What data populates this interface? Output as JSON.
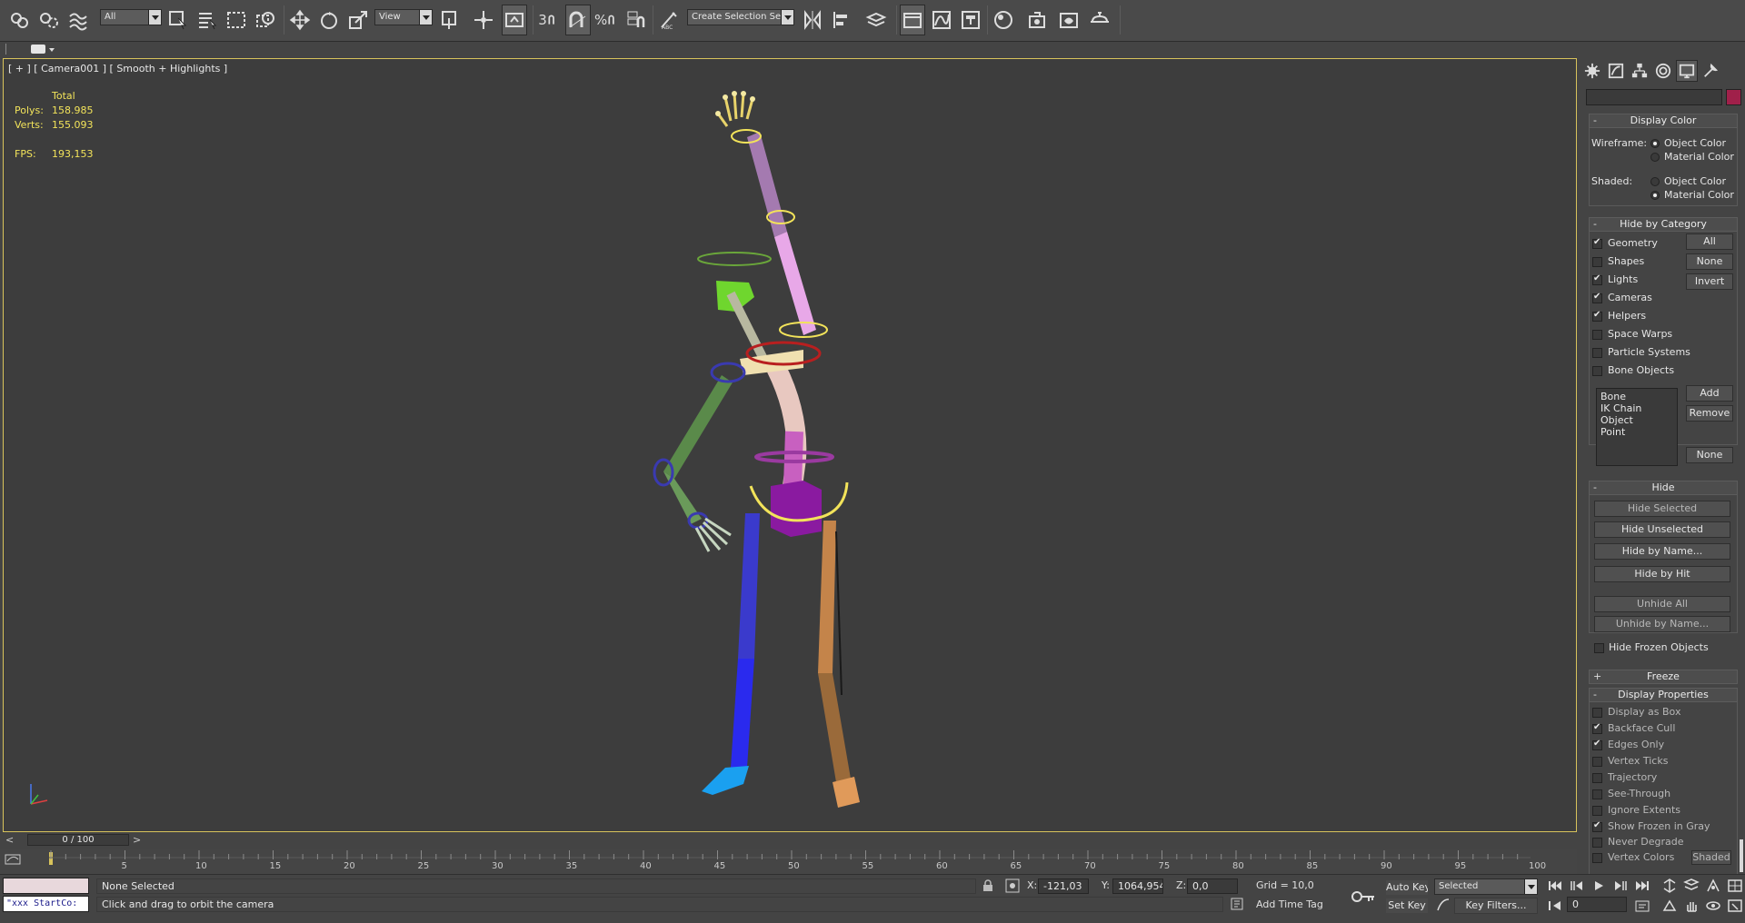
{
  "toolbar": {
    "selection_filter": "All",
    "reference_coord": "View",
    "named_selection": "Create Selection Se",
    "snap_label": "3",
    "percent_label": "%"
  },
  "viewport": {
    "label": "[ + ] [ Camera001 ] [ Smooth + Highlights ]",
    "stats": {
      "total_label": "Total",
      "polys_label": "Polys:",
      "polys_value": "158.985",
      "verts_label": "Verts:",
      "verts_value": "155.093",
      "fps_label": "FPS:",
      "fps_value": "193,153"
    }
  },
  "timeline": {
    "frame_display": "0 / 100",
    "prev": "<",
    "next": ">",
    "ticks": [
      "5",
      "10",
      "15",
      "20",
      "25",
      "30",
      "35",
      "40",
      "45",
      "50",
      "55",
      "60",
      "65",
      "70",
      "75",
      "80",
      "85",
      "90",
      "95",
      "100"
    ]
  },
  "status": {
    "maxscript_text": "\"xxx StartCo:",
    "selection_status": "None Selected",
    "prompt": "Click and drag to orbit the camera",
    "x_label": "X:",
    "x_value": "-121,03",
    "y_label": "Y:",
    "y_value": "1064,954",
    "z_label": "Z:",
    "z_value": "0,0",
    "grid": "Grid = 10,0",
    "add_time_tag": "Add Time Tag",
    "auto_key": "Auto Key",
    "set_key": "Set Key",
    "key_mode": "Selected",
    "key_filters": "Key Filters...",
    "current_frame": "0"
  },
  "command_panel": {
    "display_color": {
      "title": "Display Color",
      "wireframe_label": "Wireframe:",
      "shaded_label": "Shaded:",
      "object_color": "Object Color",
      "material_color": "Material Color"
    },
    "hide_by_category": {
      "title": "Hide by Category",
      "items": [
        {
          "label": "Geometry",
          "checked": true
        },
        {
          "label": "Shapes",
          "checked": false
        },
        {
          "label": "Lights",
          "checked": true
        },
        {
          "label": "Cameras",
          "checked": true
        },
        {
          "label": "Helpers",
          "checked": true
        },
        {
          "label": "Space Warps",
          "checked": false
        },
        {
          "label": "Particle Systems",
          "checked": false
        },
        {
          "label": "Bone Objects",
          "checked": false
        }
      ],
      "all_btn": "All",
      "none_btn": "None",
      "invert_btn": "Invert",
      "list_items": [
        "Bone",
        "IK Chain Object",
        "Point"
      ],
      "add_btn": "Add",
      "remove_btn": "Remove",
      "none_btn2": "None"
    },
    "hide": {
      "title": "Hide",
      "hide_selected": "Hide Selected",
      "hide_unselected": "Hide Unselected",
      "hide_by_name": "Hide by Name...",
      "hide_by_hit": "Hide by Hit",
      "unhide_all": "Unhide All",
      "unhide_by_name": "Unhide by Name...",
      "hide_frozen": "Hide Frozen Objects"
    },
    "freeze": {
      "title": "Freeze"
    },
    "display_properties": {
      "title": "Display Properties",
      "items": [
        {
          "label": "Display as Box",
          "checked": false
        },
        {
          "label": "Backface Cull",
          "checked": true
        },
        {
          "label": "Edges Only",
          "checked": true
        },
        {
          "label": "Vertex Ticks",
          "checked": false
        },
        {
          "label": "Trajectory",
          "checked": false
        },
        {
          "label": "See-Through",
          "checked": false
        },
        {
          "label": "Ignore Extents",
          "checked": false
        },
        {
          "label": "Show Frozen in Gray",
          "checked": true
        },
        {
          "label": "Never Degrade",
          "checked": false
        },
        {
          "label": "Vertex Colors",
          "checked": false
        }
      ],
      "shaded_btn": "Shaded"
    }
  }
}
